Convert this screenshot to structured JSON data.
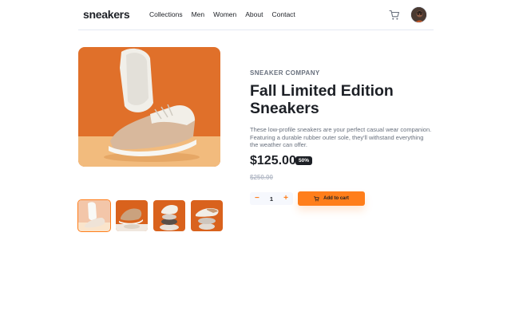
{
  "brand": {
    "logo": "sneakers"
  },
  "nav": {
    "items": [
      "Collections",
      "Men",
      "Women",
      "About",
      "Contact"
    ]
  },
  "header": {
    "cart_icon": "cart-icon",
    "avatar": "user-avatar"
  },
  "product": {
    "company": "SNEAKER COMPANY",
    "title": "Fall Limited Edition Sneakers",
    "description": "These low-profile sneakers are your perfect casual wear companion. Featuring a durable rubber outer sole, they'll withstand everything the weather can offer.",
    "price": "$125.00",
    "discount": "50%",
    "original_price": "$250.00"
  },
  "quantity": {
    "minus": "−",
    "value": "1",
    "plus": "+"
  },
  "cart_button": {
    "label": "Add to cart",
    "icon": "cart-icon"
  },
  "colors": {
    "accent": "#ff7e1b",
    "dark": "#1d2026",
    "muted": "#68707d",
    "light": "#f6f8fd",
    "background_orange": "#e0702a"
  }
}
